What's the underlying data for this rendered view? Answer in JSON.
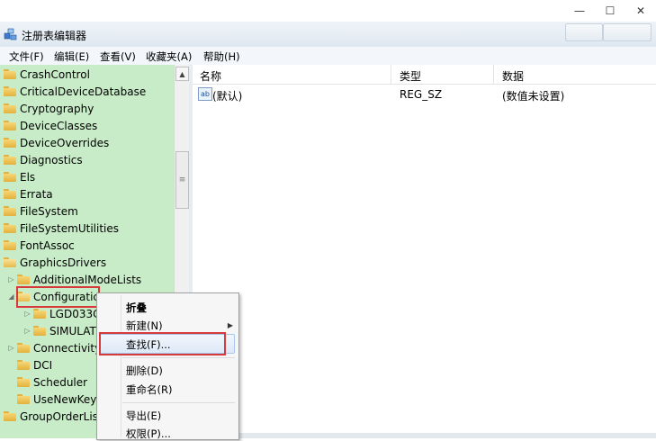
{
  "window": {
    "title": "注册表编辑器",
    "controls": {
      "minimize": "—",
      "maximize": "☐",
      "close": "✕"
    }
  },
  "menu": [
    {
      "label": "文件(F)"
    },
    {
      "label": "编辑(E)"
    },
    {
      "label": "查看(V)"
    },
    {
      "label": "收藏夹(A)"
    },
    {
      "label": "帮助(H)"
    }
  ],
  "tree": {
    "items": [
      {
        "label": "CrashControl"
      },
      {
        "label": "CriticalDeviceDatabase"
      },
      {
        "label": "Cryptography"
      },
      {
        "label": "DeviceClasses"
      },
      {
        "label": "DeviceOverrides"
      },
      {
        "label": "Diagnostics"
      },
      {
        "label": "Els"
      },
      {
        "label": "Errata"
      },
      {
        "label": "FileSystem"
      },
      {
        "label": "FileSystemUtilities"
      },
      {
        "label": "FontAssoc"
      },
      {
        "label": "GraphicsDrivers"
      },
      {
        "label": "AdditionalModeLists"
      },
      {
        "label": "Configuratic"
      },
      {
        "label": "LGD033C"
      },
      {
        "label": "SIMULAT"
      },
      {
        "label": "Connectivity"
      },
      {
        "label": "DCI"
      },
      {
        "label": "Scheduler"
      },
      {
        "label": "UseNewKey"
      },
      {
        "label": "GroupOrderList"
      }
    ],
    "scrollbar_thumb_glyph": "≡"
  },
  "list": {
    "columns": {
      "name": "名称",
      "type": "类型",
      "data": "数据"
    },
    "rows": [
      {
        "icon": "ab",
        "name": "(默认)",
        "type": "REG_SZ",
        "data": "(数值未设置)"
      }
    ]
  },
  "context_menu": {
    "collapse": "折叠",
    "new": "新建(N)",
    "find": "查找(F)...",
    "delete": "删除(D)",
    "rename": "重命名(R)",
    "export": "导出(E)",
    "permissions": "权限(P)...",
    "submenu_arrow": "▶"
  },
  "colors": {
    "tree_background": "#c8ecc8",
    "highlight_border": "#d63a3a",
    "menu_background": "#f6f6f6"
  }
}
